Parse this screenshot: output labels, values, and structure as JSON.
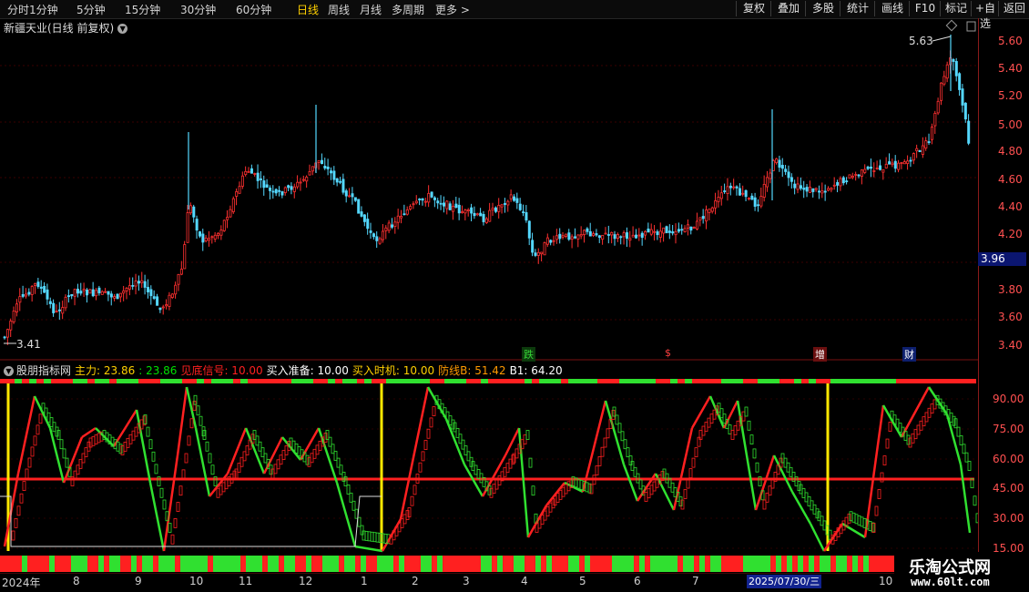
{
  "periods": [
    "分时",
    "1分钟",
    "5分钟",
    "15分钟",
    "30分钟",
    "60分钟",
    "日线",
    "周线",
    "月线",
    "多周期",
    "更多 >"
  ],
  "active_period": "日线",
  "toolbar": [
    "复权",
    "叠加",
    "多股",
    "统计",
    "画线",
    "F10",
    "标记",
    "+自选",
    "返回"
  ],
  "stock_title": "新疆天业(日线 前复权)",
  "price_axis": [
    "5.60",
    "5.40",
    "5.20",
    "5.00",
    "4.80",
    "4.60",
    "4.40",
    "4.20",
    "3.80",
    "3.60",
    "3.40"
  ],
  "current_price": "3.96",
  "high_label": "5.63",
  "low_label": "3.41",
  "events": [
    {
      "text": "跌",
      "color": "#37d437",
      "bg": "#0c3a0c"
    },
    {
      "text": "$",
      "color": "#ff4040",
      "bg": "#000"
    },
    {
      "text": "增",
      "color": "#fff",
      "bg": "#6a0f0f"
    },
    {
      "text": "财",
      "color": "#fff",
      "bg": "#0d1f6e"
    }
  ],
  "indicator": {
    "name": "股朋指标网",
    "items": [
      {
        "label": "主力:",
        "value": " 23.86",
        "color": "#ffd000"
      },
      {
        "label": ":",
        "value": " 23.86",
        "color": "#00e000"
      },
      {
        "label": "见底信号:",
        "value": " 10.00",
        "color": "#ff2020"
      },
      {
        "label": "买入准备:",
        "value": " 10.00",
        "color": "#ffffff"
      },
      {
        "label": "买入时机:",
        "value": " 10.00",
        "color": "#ffd000"
      },
      {
        "label": "防线B:",
        "value": " 51.42",
        "color": "#ff9a00"
      },
      {
        "label": "B1:",
        "value": " 64.20",
        "color": "#ffffff"
      }
    ]
  },
  "ind_axis": [
    "90.00",
    "75.00",
    "60.00",
    "45.00",
    "30.00",
    "15.00"
  ],
  "x_axis": [
    "2024年",
    "8",
    "9",
    "10",
    "11",
    "12",
    "1",
    "2",
    "3",
    "4",
    "5",
    "6",
    "7",
    "10"
  ],
  "cursor_date": "2025/07/30/三",
  "watermark": {
    "title": "乐淘公式网",
    "url": "www.60lt.com"
  },
  "colors": {
    "up": "#ff3030",
    "down": "#54d8ff",
    "green": "#30e030",
    "red": "#ff2020",
    "yellow": "#ffe800",
    "orange": "#ff7a1a"
  }
}
